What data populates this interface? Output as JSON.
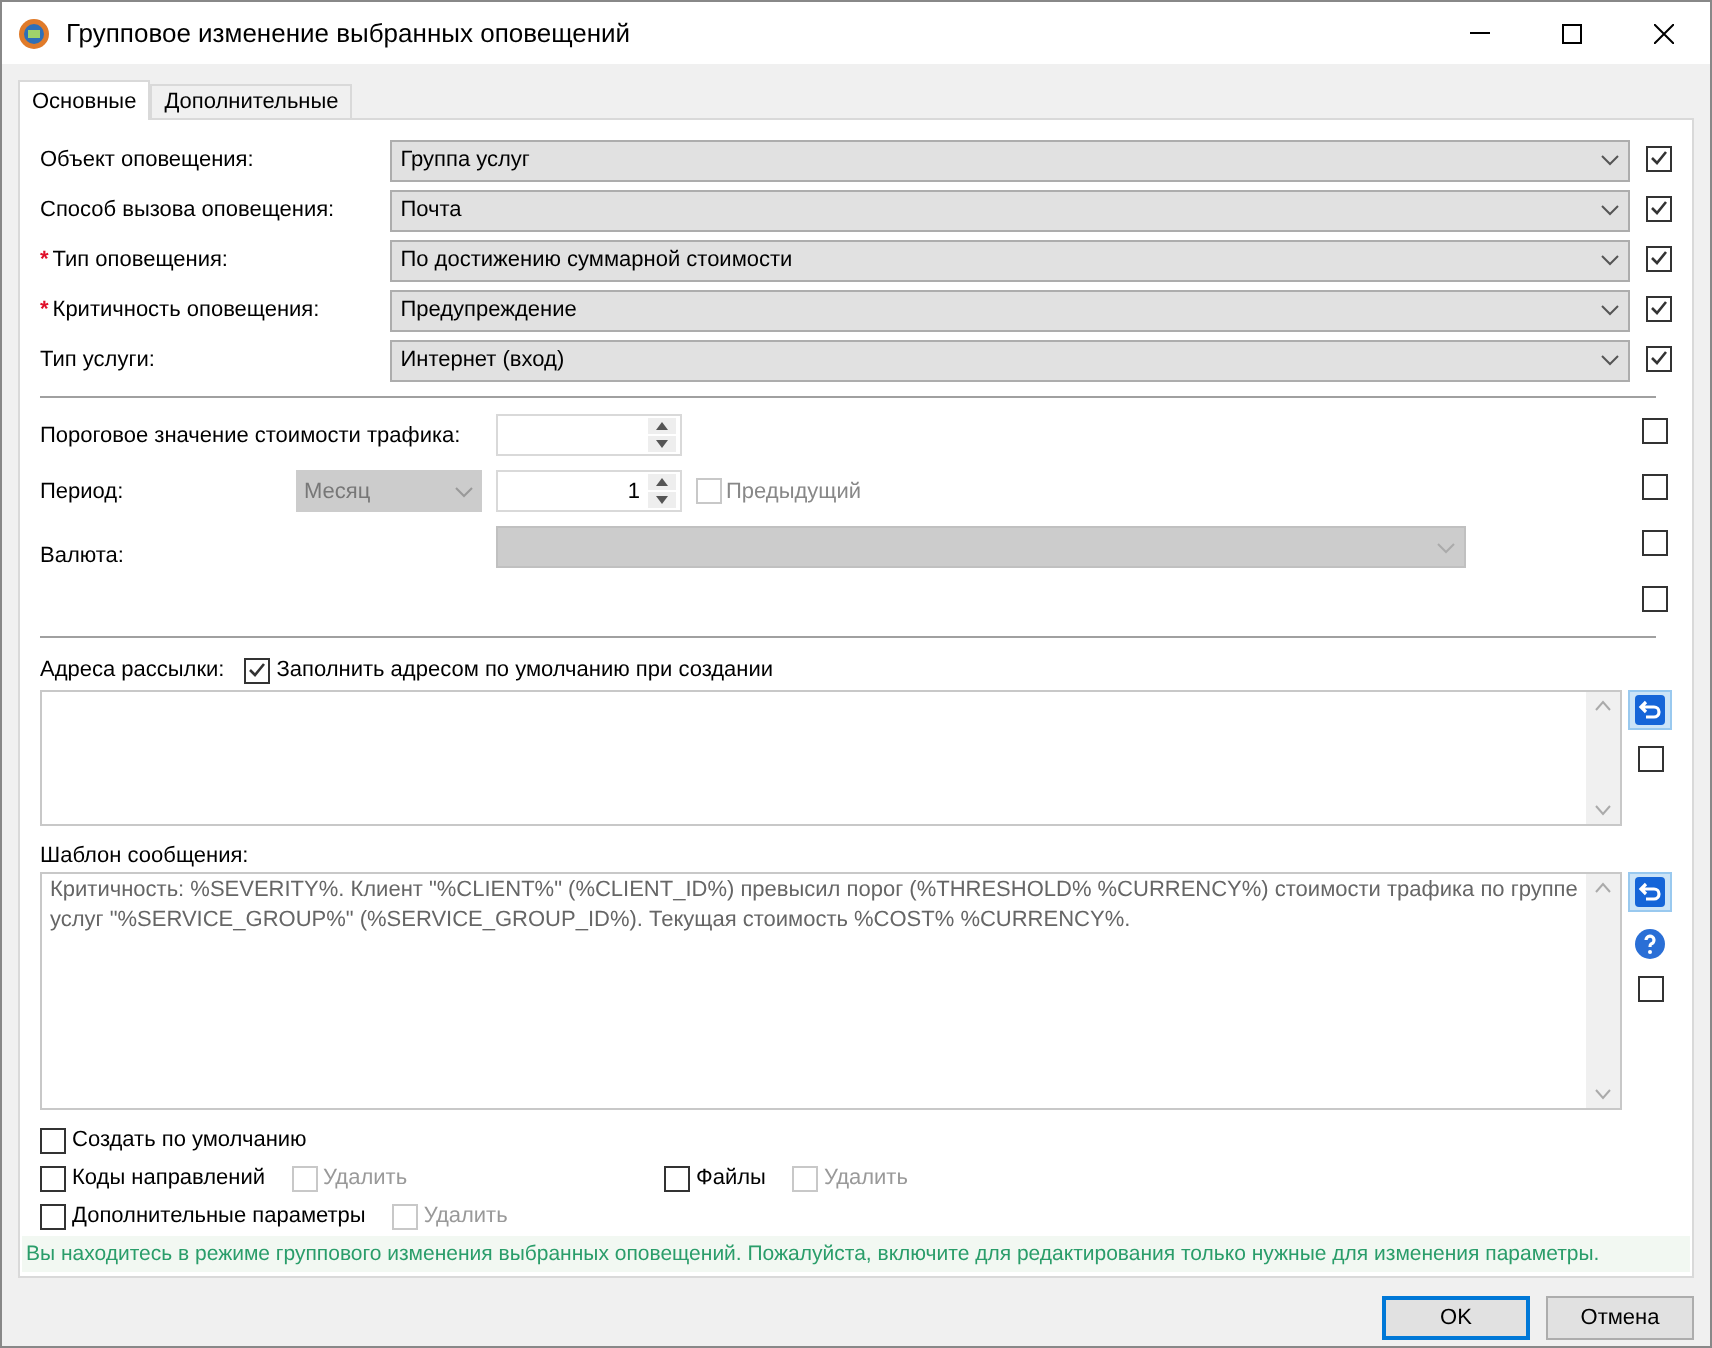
{
  "window": {
    "title": "Групповое изменение выбранных оповещений"
  },
  "tabs": [
    {
      "label": "Основные",
      "selected": true
    },
    {
      "label": "Дополнительные",
      "selected": false
    }
  ],
  "fields": [
    {
      "label": "Объект оповещения:",
      "value": "Группа услуг",
      "checked": true
    },
    {
      "label": "Способ вызова оповещения:",
      "value": "Почта",
      "checked": true
    },
    {
      "label": "Тип оповещения:",
      "marker": "*",
      "value": "По достижению суммарной стоимости",
      "checked": true
    },
    {
      "label": "Критичность оповещения:",
      "marker": "*",
      "value": "Предупреждение",
      "checked": true
    },
    {
      "label": "Тип услуги:",
      "value": "Интернет (вход)",
      "checked": true
    }
  ],
  "threshold": {
    "label": "Пороговое значение стоимости трафика:",
    "checked": false
  },
  "period": {
    "label": "Период:",
    "unit": "Месяц",
    "count": "1",
    "previous": {
      "label": "Предыдущий",
      "checked": false,
      "disabled": true
    },
    "checked": false
  },
  "currency": {
    "label": "Валюта:",
    "checked": false
  },
  "extra_checked": false,
  "mailing": {
    "label": "Адреса рассылки:",
    "fill_default": {
      "label": "Заполнить адресом по умолчанию при создании",
      "checked": true
    },
    "checked": false
  },
  "template": {
    "label": "Шаблон сообщения:",
    "text": "Критичность: %SEVERITY%. Клиент \"%CLIENT%\" (%CLIENT_ID%) превысил порог (%THRESHOLD% %CURRENCY%) стоимости трафика по группе услуг \"%SERVICE_GROUP%\" (%SERVICE_GROUP_ID%). Текущая стоимость %COST% %CURRENCY%.",
    "checked": false
  },
  "options": [
    {
      "label": "Создать по умолчанию",
      "checked": false
    },
    {
      "label": "Коды направлений",
      "checked": false,
      "delete": {
        "label": "Удалить",
        "checked": false,
        "disabled": true
      }
    },
    {
      "label": "Файлы",
      "checked": false,
      "delete": {
        "label": "Удалить",
        "checked": false,
        "disabled": true
      }
    },
    {
      "label": "Дополнительные параметры",
      "checked": false,
      "delete": {
        "label": "Удалить",
        "checked": false,
        "disabled": true
      }
    }
  ],
  "notice": "Вы находитесь в режиме группового изменения выбранных оповещений. Пожалуйста, включите для редактирования только нужные для изменения параметры.",
  "buttons": [
    {
      "label": "OK",
      "selected": true
    },
    {
      "label": "Отмена",
      "selected": false
    }
  ]
}
